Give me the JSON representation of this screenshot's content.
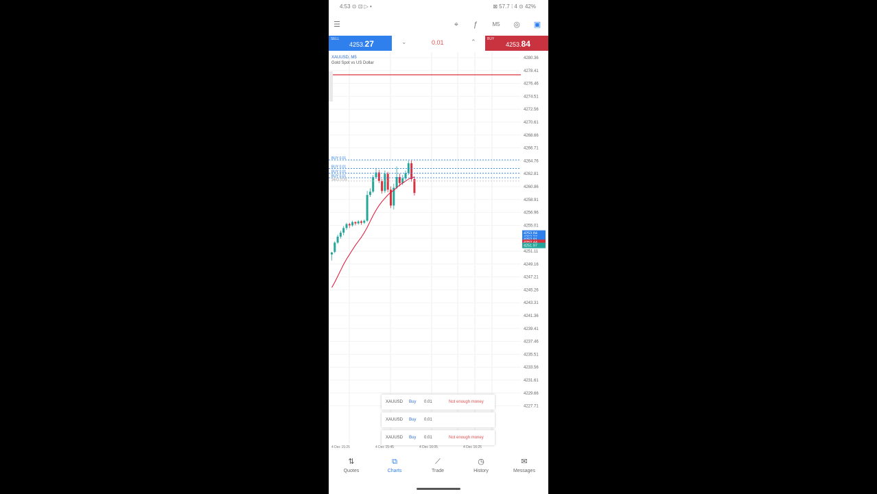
{
  "status_bar": {
    "left": "4:53 ⊙ ⊡ ▷ •",
    "right": "⊠ 57.7 ⁞ 4 ⊙ 42%"
  },
  "toolbar": {
    "icons": [
      "menu-icon",
      "crosshair-icon",
      "indicator-icon",
      "timeframe-icon",
      "objects-icon",
      "order-icon"
    ],
    "timeframe_label": "M5"
  },
  "trade_bar": {
    "sell_label": "SELL",
    "sell_price_prefix": "4253.",
    "sell_price_big": "27",
    "lot": "0.01",
    "buy_label": "BUY",
    "buy_price_prefix": "4253.",
    "buy_price_big": "84"
  },
  "chart": {
    "symbol": "XAUUSD, M5",
    "description": "Gold Spot vs US Dollar",
    "y_ticks": [
      "4280.36",
      "4278.41",
      "4276.46",
      "4274.51",
      "4272.56",
      "4270.61",
      "4268.66",
      "4266.71",
      "4264.76",
      "4262.81",
      "4260.86",
      "4258.91",
      "4256.96",
      "4255.01",
      "4253.06",
      "4251.11",
      "4249.16",
      "4247.21",
      "4245.26",
      "4243.31",
      "4241.36",
      "4239.41",
      "4237.46",
      "4235.51",
      "4233.56",
      "4231.61",
      "4229.66",
      "4227.71"
    ],
    "order_labels": [
      "BUY 0.01",
      "BUY 0.01",
      "BUY 0.01",
      "BUY 0.01",
      "SELL 0.01"
    ],
    "price_tags": [
      "4253.84",
      "4253.27",
      "4252.91",
      "4252.44",
      "4251.97"
    ],
    "time_labels": [
      "4 Dec 15:25",
      "4 Dec 15:45",
      "4 Dec 16:05",
      "4 Dec 16:25"
    ],
    "colors": {
      "bull": "#26a69a",
      "bear": "#d9323f",
      "ma": "#e01030",
      "bid_line": "#2f80ed"
    }
  },
  "notifications": [
    {
      "symbol": "XAUUSD",
      "side": "Buy",
      "volume": "0.01",
      "message": "Not enough money"
    },
    {
      "symbol": "XAUUSD",
      "side": "Buy",
      "volume": "0.01",
      "message": ""
    },
    {
      "symbol": "XAUUSD",
      "side": "Buy",
      "volume": "0.01",
      "message": "Not enough money"
    }
  ],
  "bottom_nav": [
    {
      "label": "Quotes",
      "icon": "quotes-icon"
    },
    {
      "label": "Charts",
      "icon": "charts-icon",
      "active": true
    },
    {
      "label": "Trade",
      "icon": "trade-icon"
    },
    {
      "label": "History",
      "icon": "history-icon"
    },
    {
      "label": "Messages",
      "icon": "messages-icon"
    }
  ]
}
